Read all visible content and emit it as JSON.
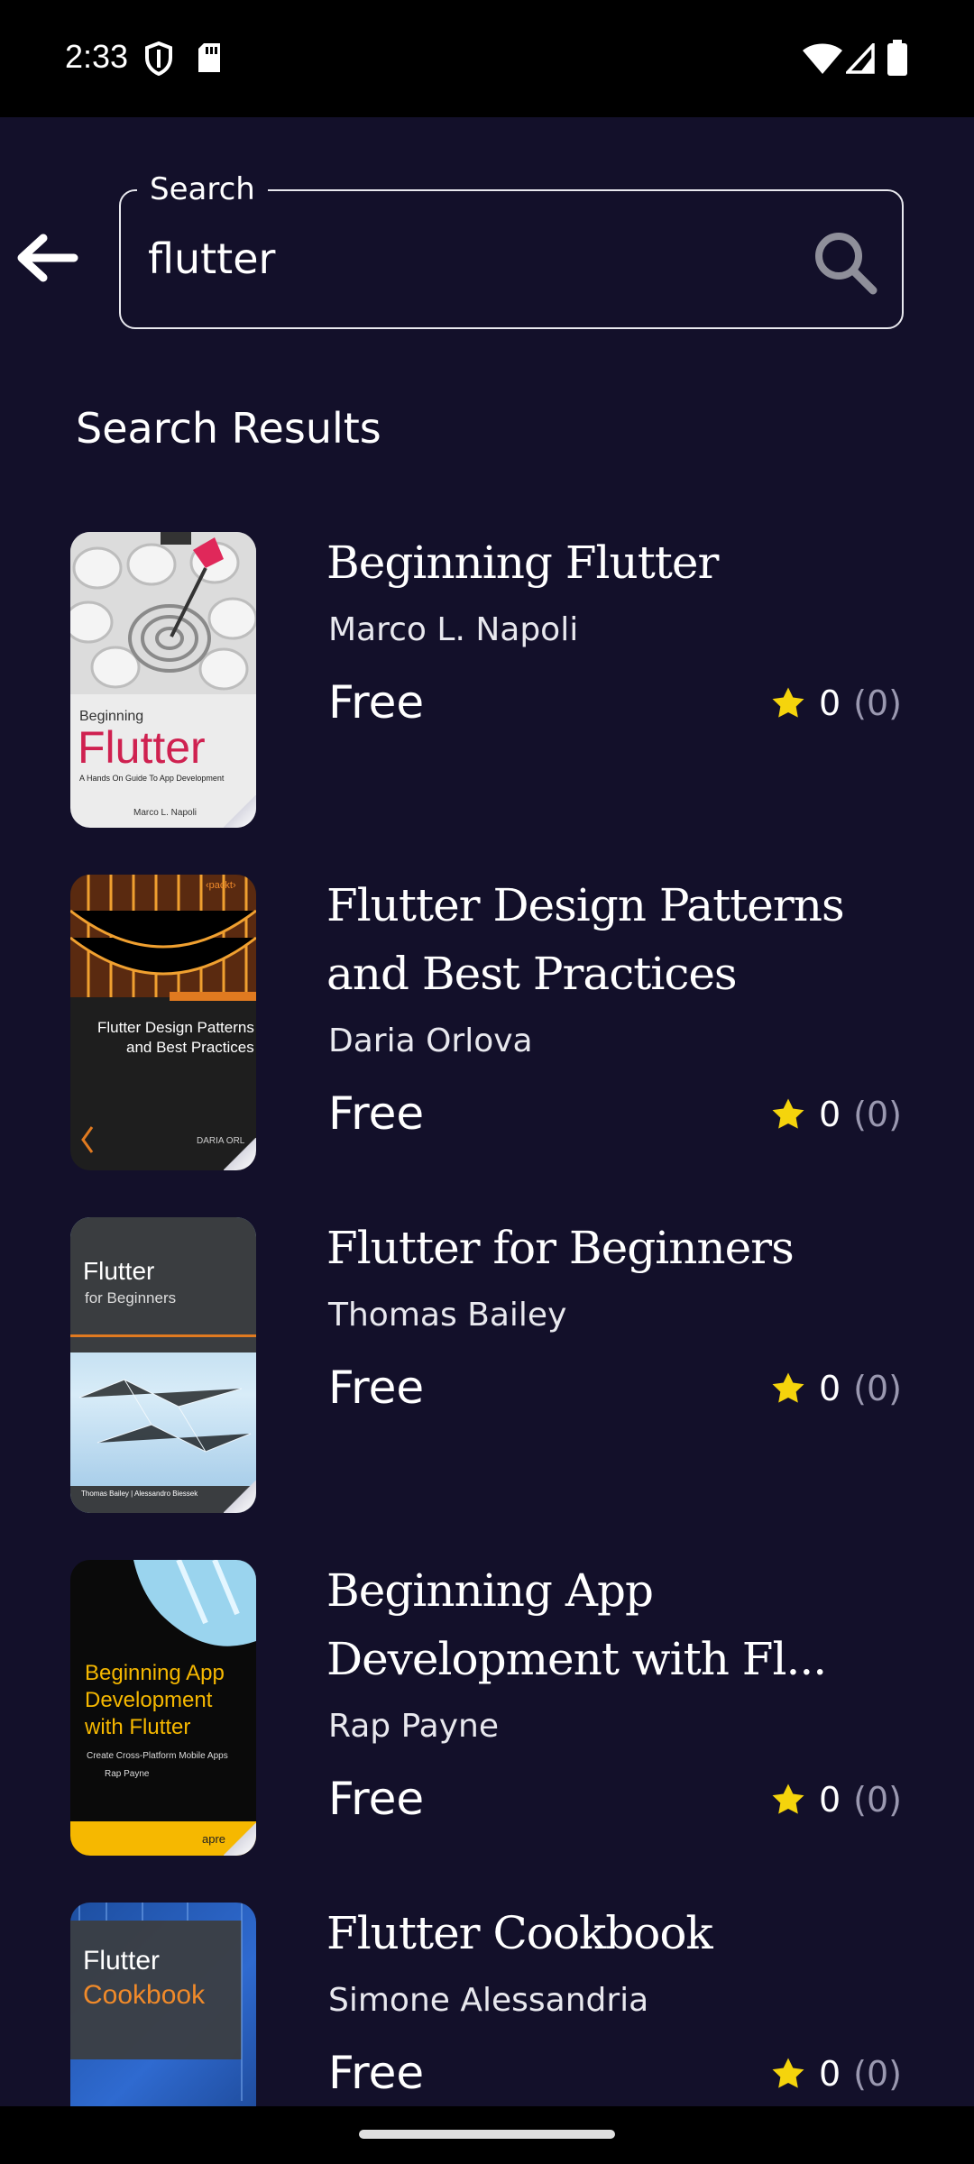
{
  "status_bar": {
    "time": "2:33"
  },
  "search": {
    "label": "Search",
    "value": "flutter"
  },
  "section_title": "Search Results",
  "colors": {
    "background": "#13102a",
    "star": "#f5d40c",
    "muted": "#9a98b0"
  },
  "books": [
    {
      "title_line1": "Beginning Flutter",
      "title_line2": "",
      "author": "Marco L. Napoli",
      "price": "Free",
      "rating": "0",
      "rating_count": "(0)",
      "cover": {
        "publisher_mark": "",
        "kicker": "Beginning",
        "headline": "Flutter",
        "subline": "A Hands On Guide To App Development",
        "byline": "Marco L. Napoli"
      }
    },
    {
      "title_line1": "Flutter Design Patterns",
      "title_line2": "and Best Practices",
      "author": "Daria Orlova",
      "price": "Free",
      "rating": "0",
      "rating_count": "(0)",
      "cover": {
        "publisher_mark": "‹packt›",
        "headline": "Flutter Design Patterns",
        "headline2": "and Best Practices",
        "byline": "DARIA ORL"
      }
    },
    {
      "title_line1": "Flutter for Beginners",
      "title_line2": "",
      "author": "Thomas Bailey",
      "price": "Free",
      "rating": "0",
      "rating_count": "(0)",
      "cover": {
        "headline": "Flutter",
        "headline2": "for Beginners",
        "byline": "Thomas Bailey | Alessandro Biessek"
      }
    },
    {
      "title_line1": "Beginning App",
      "title_line2": "Development with Fl...",
      "author": "Rap Payne",
      "price": "Free",
      "rating": "0",
      "rating_count": "(0)",
      "cover": {
        "headline": "Beginning App",
        "headline2": "Development",
        "headline3": "with Flutter",
        "subline": "Create Cross-Platform Mobile Apps",
        "byline": "Rap Payne",
        "publisher_mark": "apre"
      }
    },
    {
      "title_line1": "Flutter Cookbook",
      "title_line2": "",
      "author": "Simone Alessandria",
      "price": "Free",
      "rating": "0",
      "rating_count": "(0)",
      "cover": {
        "headline": "Flutter",
        "headline2": "Cookbook"
      }
    }
  ]
}
